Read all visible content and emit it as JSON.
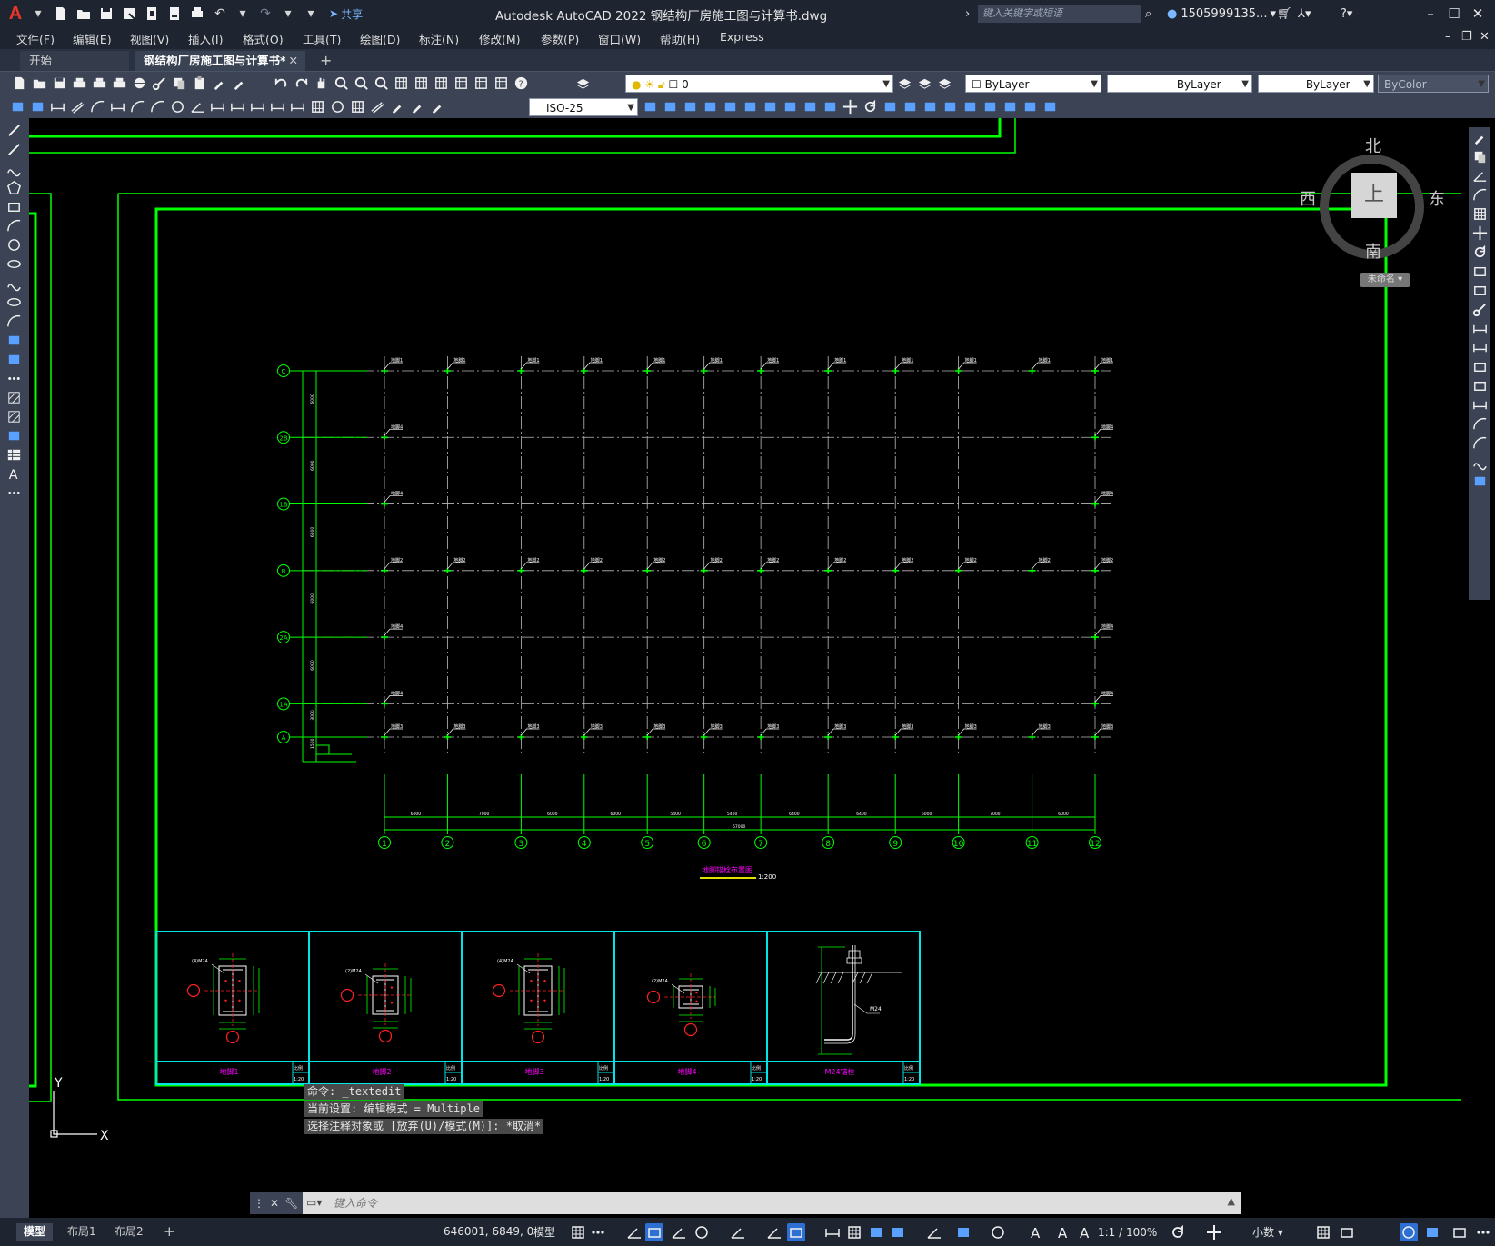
{
  "titlebar": {
    "app_title": "Autodesk AutoCAD 2022    钢结构厂房施工图与计算书.dwg",
    "share_label": "共享",
    "search_placeholder": "键入关键字或短语",
    "user": "1505999135...",
    "logo": "A"
  },
  "menu": [
    "文件(F)",
    "编辑(E)",
    "视图(V)",
    "插入(I)",
    "格式(O)",
    "工具(T)",
    "绘图(D)",
    "标注(N)",
    "修改(M)",
    "参数(P)",
    "窗口(W)",
    "帮助(H)",
    "Express"
  ],
  "tabs": {
    "start": "开始",
    "document": "钢结构厂房施工图与计算书*",
    "close": "✕",
    "add": "+"
  },
  "toolbar": {
    "layer_value": "0",
    "color_value": "ByLayer",
    "linetype_value": "ByLayer",
    "lineweight_value": "ByLayer",
    "plotstyle_value": "ByColor",
    "dimstyle_value": "ISO-25"
  },
  "viewcube": {
    "north": "北",
    "south": "南",
    "east": "东",
    "west": "西",
    "face": "上",
    "wcs": "未命名"
  },
  "drawing": {
    "plan_title": "地脚锚栓布置图",
    "plan_scale": "1:200",
    "column_axes": [
      "1",
      "2",
      "3",
      "4",
      "5",
      "6",
      "7",
      "8",
      "9",
      "10",
      "11",
      "12"
    ],
    "row_axes": [
      "C",
      "2B",
      "1B",
      "B",
      "2A",
      "1A",
      "A"
    ],
    "bay_dims": [
      "6000",
      "7000",
      "6000",
      "6000",
      "5400",
      "5400",
      "6400",
      "6400",
      "6000",
      "7000",
      "6000"
    ],
    "total_dim": "67000",
    "row_dims": [
      "6000",
      "6000",
      "6000",
      "6000",
      "6000",
      "3000",
      "1500"
    ],
    "node_top": "地脚1",
    "node_side": "地脚4",
    "node_mid": "地脚2",
    "node_bot": "地脚3",
    "details": [
      {
        "name": "地脚1",
        "scale_label": "比例",
        "scale": "1:20",
        "bolt": "(4)M24"
      },
      {
        "name": "地脚2",
        "scale_label": "比例",
        "scale": "1:20",
        "bolt": "(2)M24"
      },
      {
        "name": "地脚3",
        "scale_label": "比例",
        "scale": "1:20",
        "bolt": "(4)M24"
      },
      {
        "name": "地脚4",
        "scale_label": "比例",
        "scale": "1:20",
        "bolt": "(2)M24"
      },
      {
        "name": "M24锚栓",
        "scale_label": "比例",
        "scale": "1:20",
        "bolt": "M24"
      }
    ],
    "ucs_y": "Y",
    "ucs_x": "X"
  },
  "command": {
    "history": [
      "命令: _textedit",
      "当前设置: 编辑模式 = Multiple",
      "选择注释对象或 [放弃(U)/模式(M)]: *取消*"
    ],
    "placeholder": "键入命令"
  },
  "statusbar": {
    "layout_tabs": [
      "模型",
      "布局1",
      "布局2"
    ],
    "add_layout": "+",
    "coords": "646001, 6849, 0",
    "model_label": "模型",
    "scale": "1:1 / 100%",
    "units": "小数"
  },
  "colors": {
    "bg": "#000000",
    "ui_dark": "#1e2430",
    "ui_mid": "#3b4354",
    "green": "#00ff00",
    "cyan": "#00e5e5",
    "magenta": "#ff00ff",
    "red": "#ff2020",
    "white": "#ffffff"
  }
}
